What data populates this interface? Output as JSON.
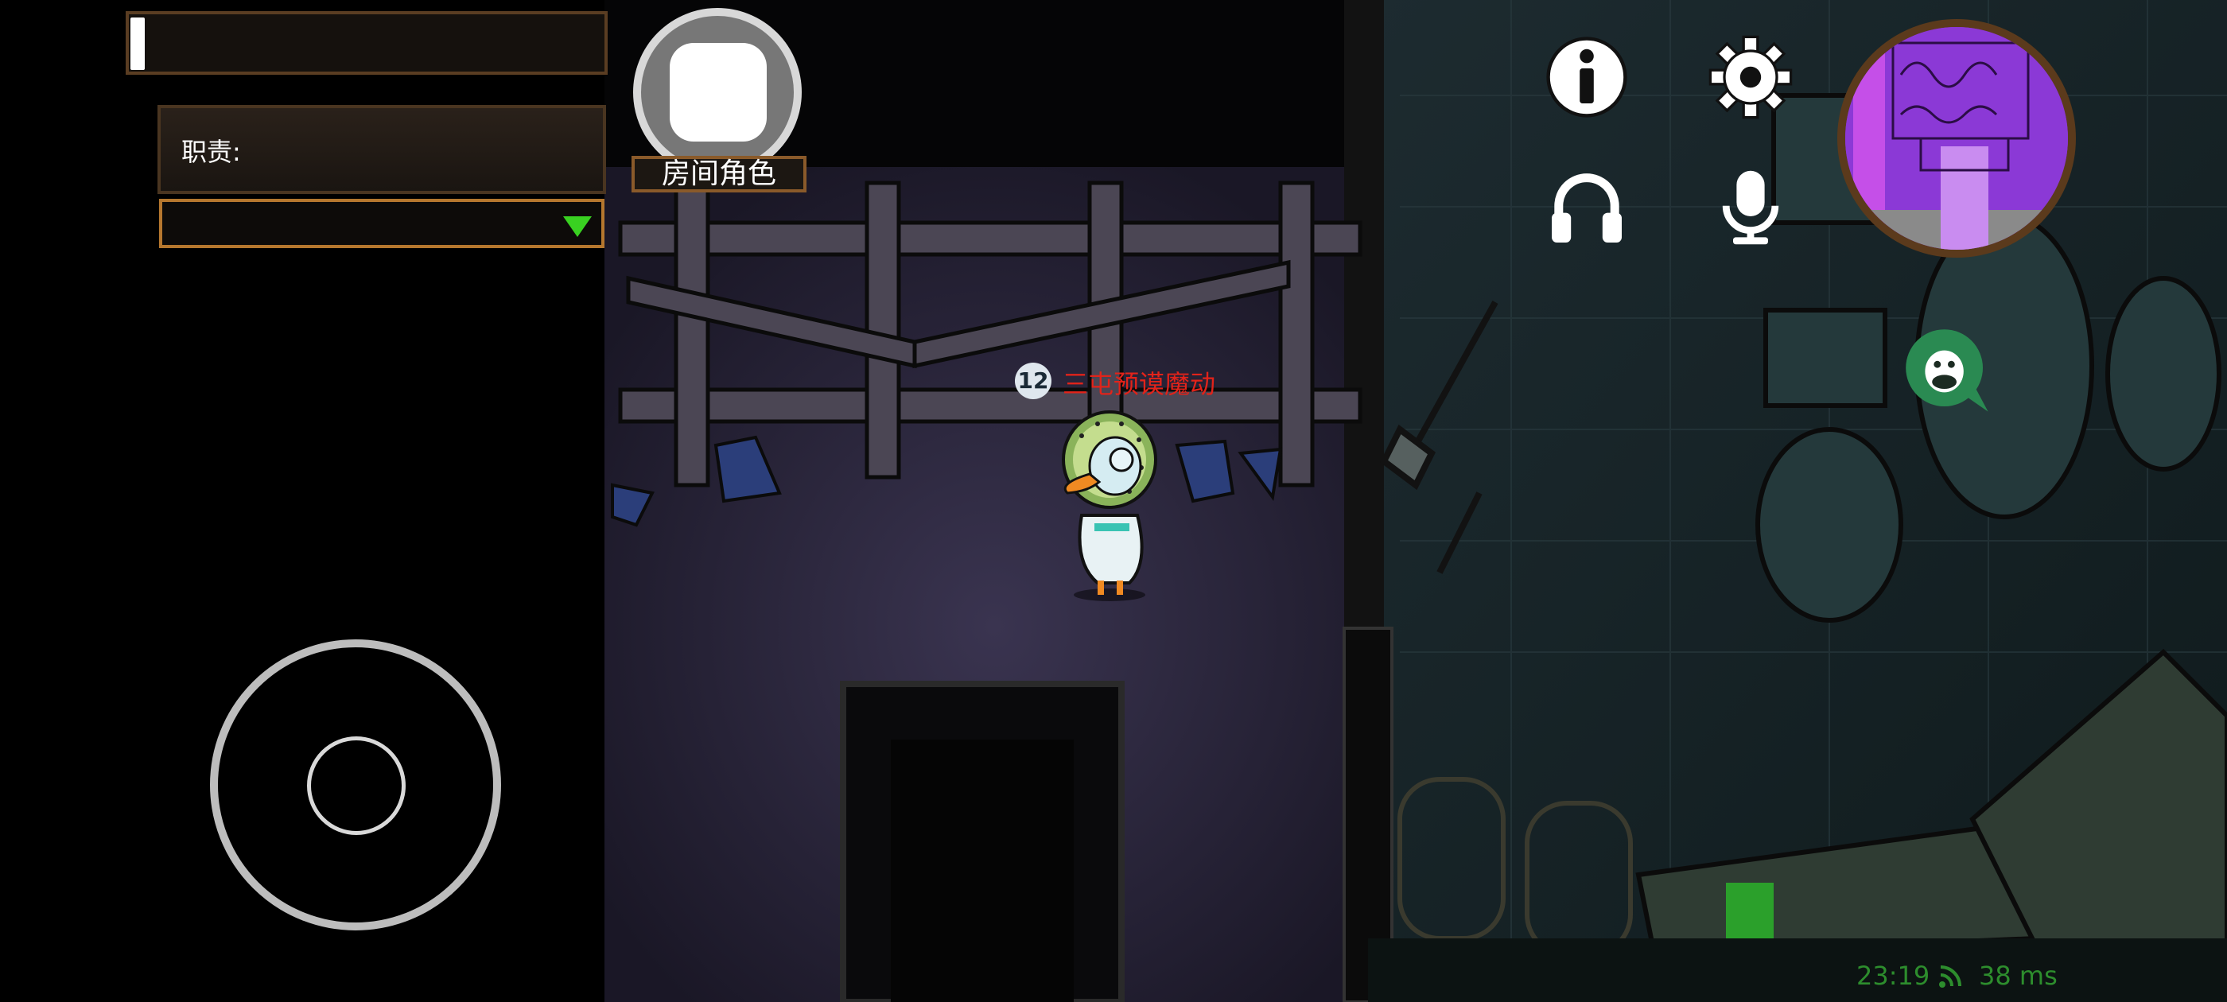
{
  "hud": {
    "role_label": "职责:",
    "room_role_label": "房间角色",
    "dropdown_value": ""
  },
  "player": {
    "number": "12",
    "name": "三屯预谟魔动"
  },
  "status": {
    "time": "23:19",
    "ping": "38 ms"
  },
  "icons": [
    "info-icon",
    "gear-icon",
    "headphones-icon",
    "microphone-icon",
    "chat-icon",
    "wifi-icon"
  ],
  "colors": {
    "player_name": "#e2231a",
    "status_text": "#2d8d2d",
    "dropdown_arrow": "#39d121",
    "minimap_purple": "#8b39d6"
  }
}
